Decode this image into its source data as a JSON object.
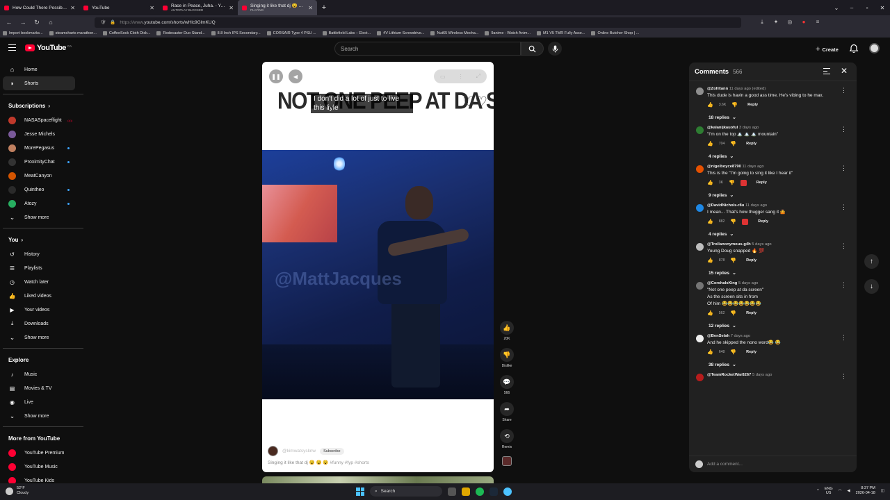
{
  "browser": {
    "tabs": [
      {
        "label": "How Could There Possibly Be M",
        "sub": "",
        "color": "#ff0033",
        "active": false
      },
      {
        "label": "YouTube",
        "sub": "",
        "color": "#ff0033",
        "active": false
      },
      {
        "label": "Race in Peace, Juha. - YouTube",
        "sub": "AUTOPLAY BLOCKED",
        "color": "#ff0033",
        "active": false
      },
      {
        "label": "Singing it like that dj 😵 😵 😵",
        "sub": "PLAYING",
        "color": "#ff0033",
        "active": true
      }
    ],
    "url_prefix": "https://www.",
    "url": "youtube.com/shorts/wHlc9GlmKUQ",
    "bookmarks": [
      "Import bookmarks...",
      "steamcharts marathon...",
      "CoffeeSock Cloth Disk...",
      "Rodecaster Duo Stand...",
      "8.8 Inch IPS Secondary...",
      "CORSAIR Type 4 PSU ...",
      "Battlefield Labs – Elect...",
      "4V Lithium Screwdrive...",
      "Nut65 Wireless Mecha...",
      "9anime - Watch Anim...",
      "M1 V5 TMR Fully Asse...",
      "Online Butcher Shop | ..."
    ]
  },
  "header": {
    "logo_text": "YouTube",
    "logo_country": "CA",
    "search_placeholder": "Search",
    "create_label": "Create"
  },
  "sidebar": {
    "main": [
      {
        "label": "Home",
        "icon": "home-icon",
        "glyph": "⌂",
        "active": false
      },
      {
        "label": "Shorts",
        "icon": "shorts-icon",
        "glyph": "◗",
        "active": true
      }
    ],
    "subscriptions_title": "Subscriptions",
    "subscriptions": [
      {
        "label": "NASASpaceflight",
        "color": "#c0392b",
        "badge": "live"
      },
      {
        "label": "Jesse Michels",
        "color": "#7a5a9a",
        "badge": ""
      },
      {
        "label": "MorePegasus",
        "color": "#c08060",
        "badge": "dot"
      },
      {
        "label": "ProximityChat",
        "color": "#333333",
        "badge": "dot"
      },
      {
        "label": "MeatCanyon",
        "color": "#d35400",
        "badge": ""
      },
      {
        "label": "Quintheo",
        "color": "#2a2a2a",
        "badge": "dot"
      },
      {
        "label": "Atozy",
        "color": "#27ae60",
        "badge": "dot"
      }
    ],
    "show_more": "Show more",
    "you_title": "You",
    "you": [
      {
        "label": "History",
        "glyph": "↺"
      },
      {
        "label": "Playlists",
        "glyph": "☰"
      },
      {
        "label": "Watch later",
        "glyph": "◷"
      },
      {
        "label": "Liked videos",
        "glyph": "👍"
      },
      {
        "label": "Your videos",
        "glyph": "▶"
      },
      {
        "label": "Downloads",
        "glyph": "⤓"
      }
    ],
    "explore_title": "Explore",
    "explore": [
      {
        "label": "Music",
        "glyph": "♪"
      },
      {
        "label": "Movies & TV",
        "glyph": "▤"
      },
      {
        "label": "Live",
        "glyph": "◉"
      }
    ],
    "more_title": "More from YouTube",
    "more": [
      {
        "label": "YouTube Premium"
      },
      {
        "label": "YouTube Music"
      },
      {
        "label": "YouTube Kids"
      }
    ]
  },
  "player": {
    "overlay_text": "NOT ONE PEEP AT DA SCREEN",
    "subtitle": "I don't did a lot of just to live this liyle",
    "watermark": "@MattJacques",
    "channel": "@kimwatsysknw",
    "subscribe_label": "Subscribe",
    "title": "Singing it like that dj 😵 😵 😵",
    "hashtags": "#funny #fyp #shorts"
  },
  "actions": [
    {
      "label": "20K",
      "glyph": "👍",
      "name": "like-button"
    },
    {
      "label": "Dislike",
      "glyph": "👎",
      "name": "dislike-button"
    },
    {
      "label": "566",
      "glyph": "💬",
      "name": "comments-button"
    },
    {
      "label": "Share",
      "glyph": "➦",
      "name": "share-button"
    },
    {
      "label": "Remix",
      "glyph": "⟲",
      "name": "remix-button"
    }
  ],
  "comments": {
    "title": "Comments",
    "count": "566",
    "add_placeholder": "Add a comment...",
    "items": [
      {
        "user": "@Zohltann",
        "ago": "11 days ago (edited)",
        "text": "This dude is havin a good ass time. He's vibing to he max.",
        "likes": "3.6K",
        "replies": "18 replies",
        "avatar": "#8e8e8e",
        "heart": false
      },
      {
        "user": "@kalanijkauoful",
        "ago": "3 days ago",
        "text": "\"I'm on the top 🏔️ 🏔️ 🏔️ mountain\"",
        "likes": "704",
        "replies": "4 replies",
        "avatar": "#2e7d32",
        "heart": false
      },
      {
        "user": "@nigelboyce8790",
        "ago": "11 days ago",
        "text": "This is the \"I'm going to sing it like I hear it\"",
        "likes": "3K",
        "replies": "9 replies",
        "avatar": "#e65100",
        "heart": true
      },
      {
        "user": "@DavidNichols-r8u",
        "ago": "11 days ago",
        "text": "I mean... That's how thugger sang it 🤷",
        "likes": "882",
        "replies": "4 replies",
        "avatar": "#1e88e5",
        "heart": true
      },
      {
        "user": "@Trollanonymous-g4h",
        "ago": "5 days ago",
        "text": "Young Doug snapped 🔥 💯",
        "likes": "878",
        "replies": "15 replies",
        "avatar": "#bdbdbd",
        "heart": false
      },
      {
        "user": "@CorshalsKing",
        "ago": "5 days ago",
        "text": "\"Not one peep at da screen\"\nAs the screen sits in from\nOf him 😂😂😂😂😂😂😂",
        "likes": "562",
        "replies": "12 replies",
        "avatar": "#757575",
        "heart": false
      },
      {
        "user": "@BenSelah",
        "ago": "7 days ago",
        "text": "And he skipped the nono word😂 😂",
        "likes": "648",
        "replies": "38 replies",
        "avatar": "#eeeeee",
        "heart": false
      },
      {
        "user": "@TeamRocketWar8267",
        "ago": "5 days ago",
        "text": "",
        "likes": "",
        "replies": "",
        "avatar": "#b71c1c",
        "heart": false
      }
    ]
  },
  "taskbar": {
    "temp": "52°F",
    "condition": "Cloudy",
    "search": "Search",
    "lang1": "ENG",
    "lang2": "US",
    "time": "8:37 PM",
    "date": "2026-04-18"
  }
}
